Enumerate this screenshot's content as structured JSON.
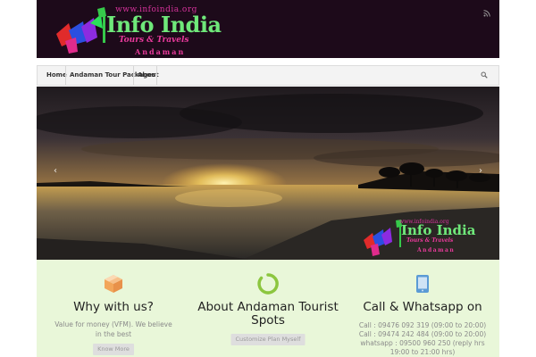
{
  "header": {
    "logo": {
      "url": "www.infoindia.org",
      "brand": "Info India",
      "tagline": "Tours & Travels",
      "destination": "Andaman"
    },
    "rss_icon": "rss-icon"
  },
  "nav": {
    "items": [
      {
        "label": "Home"
      },
      {
        "label": "Andaman Tour Packages"
      },
      {
        "label": "About"
      }
    ],
    "search_icon": "search-icon"
  },
  "slider": {
    "watermark": {
      "url": "www.infoindia.org",
      "brand": "Info India",
      "tagline": "Tours & Travels",
      "destination": "Andaman"
    },
    "prev_icon": "chevron-left-icon",
    "next_icon": "chevron-right-icon"
  },
  "features": [
    {
      "icon": "cube-icon",
      "title": "Why with us?",
      "text": "Value for money (VFM). We believe in the best",
      "button": "Know More"
    },
    {
      "icon": "spinner-icon",
      "title": "About Andaman Tourist Spots",
      "text": "",
      "button": "Customize Plan Myself"
    },
    {
      "icon": "tablet-icon",
      "title": "Call & Whatsapp on",
      "lines": [
        "Call : 09476 092 319 (09:00 to 20:00)",
        "Call : 09474 242 484 (09:00 to 20:00)",
        "whatsapp : 09500 960 250 (reply hrs",
        "19:00 to 21:00 hrs)"
      ]
    }
  ],
  "colors": {
    "header_bg": "#1d0a1a",
    "features_bg": "#e9f7d9",
    "brand_green": "#6fe87a",
    "brand_pink": "#e83a9b",
    "icon_orange": "#f2a65a",
    "icon_green": "#8cc63f",
    "icon_blue": "#5b9bd5"
  }
}
